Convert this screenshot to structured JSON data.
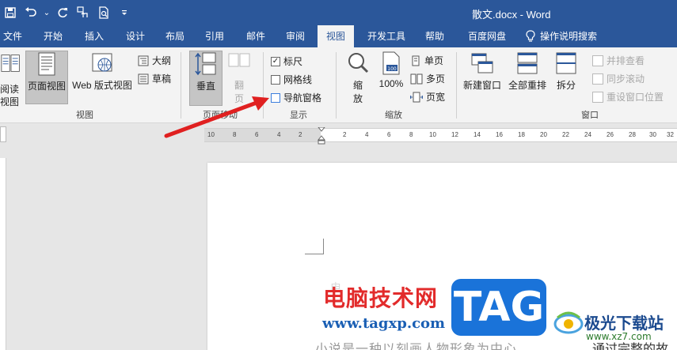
{
  "title_bar": {
    "doc_title": "散文.docx - Word",
    "qat": [
      "save-icon",
      "undo-icon",
      "redo-icon",
      "touch-mode-icon",
      "print-preview-icon",
      "customize-qat-icon"
    ],
    "qat_undo_dropdown": "⌄"
  },
  "tabs": {
    "file": "文件",
    "home": "开始",
    "insert": "插入",
    "design": "设计",
    "layout": "布局",
    "references": "引用",
    "mailings": "邮件",
    "review": "审阅",
    "view": "视图",
    "developer": "开发工具",
    "help": "帮助",
    "baidu": "百度网盘",
    "tell_me": "操作说明搜索"
  },
  "ribbon": {
    "views": {
      "read_mode_1": "阅读",
      "read_mode_2": "视图",
      "print_layout": "页面视图",
      "web_layout": "Web 版式视图",
      "outline": "大纲",
      "draft": "草稿",
      "label": "视图"
    },
    "page_movement": {
      "vertical": "垂直",
      "side_to_side_1": "翻",
      "side_to_side_2": "页",
      "label": "页面移动"
    },
    "show": {
      "ruler": "标尺",
      "ruler_checked": "✓",
      "gridlines": "网格线",
      "nav_pane": "导航窗格",
      "label": "显示"
    },
    "zoom": {
      "zoom_1": "缩",
      "zoom_2": "放",
      "hundred": "100%",
      "one_page": "单页",
      "multi_page": "多页",
      "page_width": "页宽",
      "label": "缩放"
    },
    "window": {
      "new_window": "新建窗口",
      "arrange_all": "全部重排",
      "split": "拆分",
      "side_by_side": "并排查看",
      "sync_scroll": "同步滚动",
      "reset_position": "重设窗口位置",
      "label": "窗口"
    }
  },
  "ruler": {
    "left_nums": [
      "10",
      "8",
      "6",
      "4",
      "2"
    ],
    "right_nums": [
      "2",
      "4",
      "6",
      "8",
      "10",
      "12",
      "14",
      "16",
      "18",
      "20",
      "22",
      "24",
      "26",
      "28",
      "30",
      "32"
    ]
  },
  "document": {
    "ghost_text": "电",
    "para_text": "小说是一种以刻画人物形象为中心",
    "para_text_right": "通过完整的故"
  },
  "watermark": {
    "cn_site": "电脑技术网",
    "url": "www.tagxp.com",
    "tag": "TAG",
    "site_name": "极光下载站",
    "site_url": "www.xz7.com"
  }
}
